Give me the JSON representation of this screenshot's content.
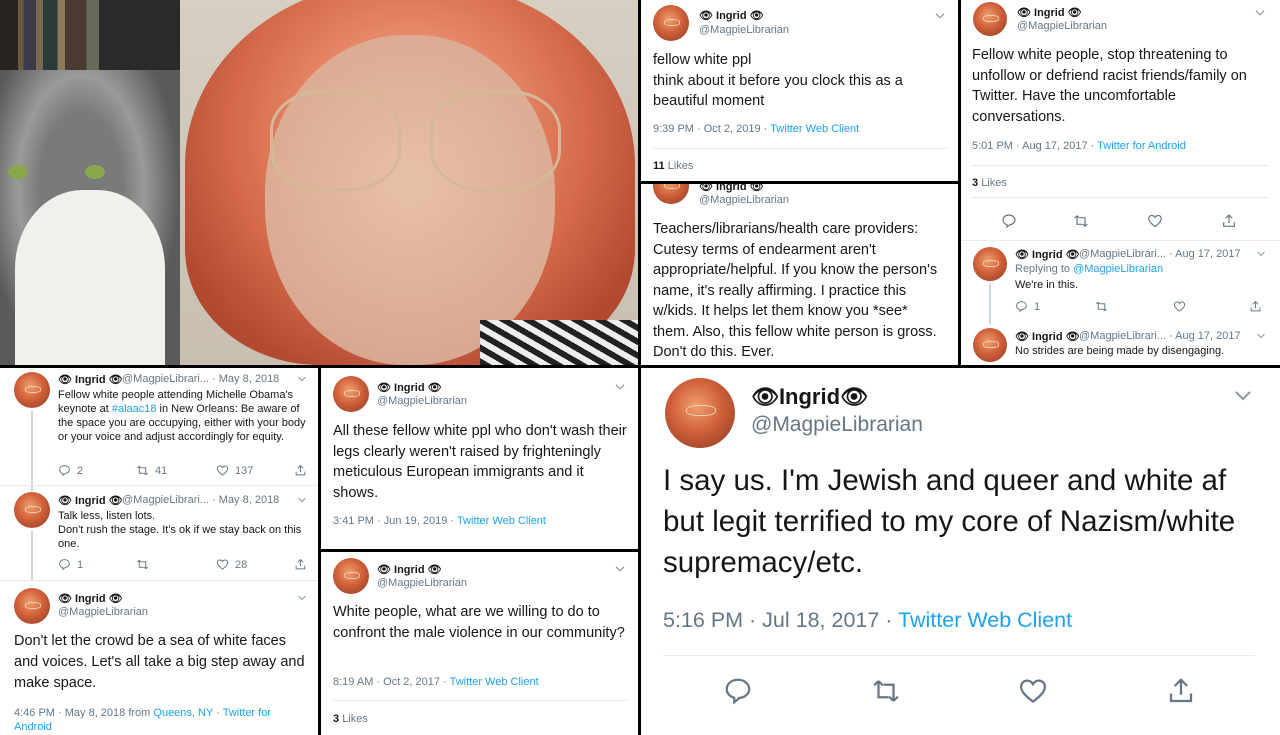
{
  "user": {
    "name": "Ingrid",
    "handle": "@MagpieLibrarian",
    "handle_short": "@MagpieLibrari...",
    "eye": "👁"
  },
  "tweets": {
    "t1": {
      "text": "fellow white ppl\nthink about it before you clock this as a beautiful moment",
      "time": "9:39 PM · Oct 2, 2019 · ",
      "client": "Twitter Web Client",
      "likes_n": "11",
      "likes_l": "Likes"
    },
    "t2": {
      "text": "Fellow white people, stop threatening to unfollow or defriend racist friends/family on Twitter. Have the uncomfortable conversations.",
      "time": "5:01 PM · Aug 17, 2017 · ",
      "client": "Twitter for Android",
      "likes_n": "3",
      "likes_l": "Likes"
    },
    "t3": {
      "text": "Teachers/librarians/health care providers: Cutesy terms of endearment aren't appropriate/helpful. If you know the person's name, it's really affirming. I practice this w/kids. It helps let them know you *see* them. Also, this fellow white person is gross. Don't do this. Ever."
    },
    "t4": {
      "date": "· Aug 17, 2017",
      "replying": "Replying to ",
      "reply_to": "@MagpieLibrarian",
      "text": "We're in this.",
      "replies": "1"
    },
    "t5": {
      "date": "· Aug 17, 2017",
      "text": "No strides are being made by disengaging."
    },
    "t6": {
      "date": "· May 8, 2018",
      "text_a": "Fellow white people attending Michelle Obama's keynote at ",
      "hashtag": "#alaac18",
      "text_b": " in New Orleans: Be aware of the space you are occupying, either with your body or your voice and adjust accordingly for equity.",
      "replies": "2",
      "retweets": "41",
      "likes": "137"
    },
    "t7": {
      "date": "· May 8, 2018",
      "text": "Talk less, listen lots.\nDon't rush the stage. It's ok if we stay back on this one.",
      "replies": "1",
      "likes": "28"
    },
    "t8": {
      "text": "Don't let the crowd be a sea of white faces and voices. Let's all take a big step away and make space.",
      "time": "4:46 PM · May 8, 2018 from ",
      "place": "Queens, NY",
      "sep": " · ",
      "client": "Twitter for Android"
    },
    "t9": {
      "text": "All these fellow white ppl who don't wash their legs clearly weren't raised by frighteningly meticulous European immigrants and it shows.",
      "time": "3:41 PM · Jun 19, 2019 · ",
      "client": "Twitter Web Client"
    },
    "t10": {
      "text": "White people, what are we willing to do to confront the male violence in our community?",
      "time": "8:19 AM · Oct 2, 2017 · ",
      "client": "Twitter Web Client",
      "likes_n": "3",
      "likes_l": "Likes"
    },
    "t11": {
      "text": "I say us. I'm Jewish and queer and white af but legit terrified to my core of Nazism/white supremacy/etc.",
      "time": "5:16 PM · Jul 18, 2017 · ",
      "client": "Twitter Web Client"
    }
  },
  "colors": {
    "link": "#1da1f2",
    "muted": "#657786",
    "text": "#14171a"
  },
  "icons": [
    "reply-icon",
    "retweet-icon",
    "like-icon",
    "share-icon",
    "chevron-down-icon",
    "eye-icon"
  ]
}
